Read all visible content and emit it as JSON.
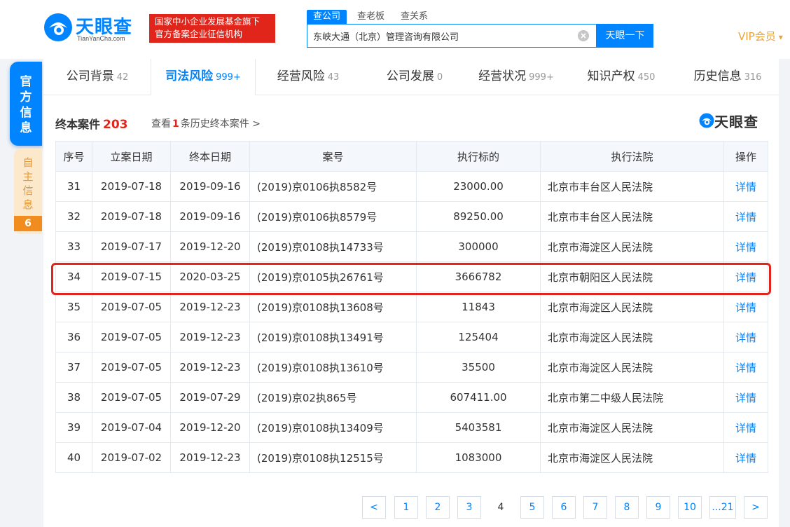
{
  "header": {
    "logo_text": "天眼查",
    "logo_sub": "TianYanCha.com",
    "banner_line1": "国家中小企业发展基金旗下",
    "banner_line2": "官方备案企业征信机构",
    "search_tabs": [
      "查公司",
      "查老板",
      "查关系"
    ],
    "search_value": "东峡大通（北京）管理咨询有限公司",
    "search_button": "天眼一下",
    "vip_label": "VIP会员"
  },
  "side": {
    "official_label": "官方信息",
    "self_label": "自主信息",
    "self_badge": "6"
  },
  "nav": {
    "tabs": [
      {
        "label": "公司背景",
        "count": "42"
      },
      {
        "label": "司法风险",
        "count": "999+"
      },
      {
        "label": "经营风险",
        "count": "43"
      },
      {
        "label": "公司发展",
        "count": "0"
      },
      {
        "label": "经营状况",
        "count": "999+"
      },
      {
        "label": "知识产权",
        "count": "450"
      },
      {
        "label": "历史信息",
        "count": "316"
      }
    ]
  },
  "section": {
    "title": "终本案件",
    "count": "203",
    "history_prefix": "查看",
    "history_count": "1",
    "history_suffix": "条历史终本案件 >",
    "brand_text": "天眼查"
  },
  "table": {
    "columns": [
      "序号",
      "立案日期",
      "终本日期",
      "案号",
      "执行标的",
      "执行法院",
      "操作"
    ],
    "rows": [
      [
        "31",
        "2019-07-18",
        "2019-09-16",
        "(2019)京0106执8582号",
        "23000.00",
        "北京市丰台区人民法院",
        "详情"
      ],
      [
        "32",
        "2019-07-18",
        "2019-09-16",
        "(2019)京0106执8579号",
        "89250.00",
        "北京市丰台区人民法院",
        "详情"
      ],
      [
        "33",
        "2019-07-17",
        "2019-12-20",
        "(2019)京0108执14733号",
        "300000",
        "北京市海淀区人民法院",
        "详情"
      ],
      [
        "34",
        "2019-07-15",
        "2020-03-25",
        "(2019)京0105执26761号",
        "3666782",
        "北京市朝阳区人民法院",
        "详情"
      ],
      [
        "35",
        "2019-07-05",
        "2019-12-23",
        "(2019)京0108执13608号",
        "11843",
        "北京市海淀区人民法院",
        "详情"
      ],
      [
        "36",
        "2019-07-05",
        "2019-12-23",
        "(2019)京0108执13491号",
        "125404",
        "北京市海淀区人民法院",
        "详情"
      ],
      [
        "37",
        "2019-07-05",
        "2019-12-23",
        "(2019)京0108执13610号",
        "35500",
        "北京市海淀区人民法院",
        "详情"
      ],
      [
        "38",
        "2019-07-05",
        "2019-07-29",
        "(2019)京02执865号",
        "607411.00",
        "北京市第二中级人民法院",
        "详情"
      ],
      [
        "39",
        "2019-07-04",
        "2019-12-20",
        "(2019)京0108执13409号",
        "5403581",
        "北京市海淀区人民法院",
        "详情"
      ],
      [
        "40",
        "2019-07-02",
        "2019-12-23",
        "(2019)京0108执12515号",
        "1083000",
        "北京市海淀区人民法院",
        "详情"
      ]
    ],
    "highlighted_row_no": "34"
  },
  "pager": {
    "prev": "<",
    "pages": [
      "1",
      "2",
      "3",
      "4",
      "5",
      "6",
      "7",
      "8",
      "9",
      "10",
      "...21"
    ],
    "current": "4",
    "next": ">"
  },
  "colors": {
    "accent": "#0084ff",
    "highlight": "#e1251b",
    "vip": "#e8a33d"
  }
}
